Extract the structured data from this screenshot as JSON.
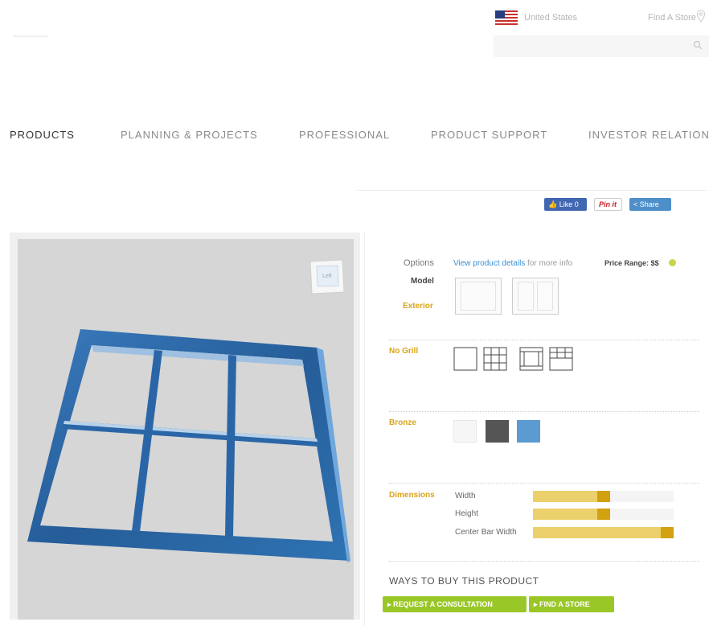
{
  "header": {
    "country": "United States",
    "find_store": "Find A Store"
  },
  "nav": {
    "items": [
      "PRODUCTS",
      "PLANNING & PROJECTS",
      "PROFESSIONAL",
      "PRODUCT SUPPORT",
      "INVESTOR RELATIONS"
    ],
    "active": "PRODUCTS"
  },
  "social": {
    "like": "Like 0",
    "pin": "Pin it",
    "share": "Share"
  },
  "viewer": {
    "cube_face": "Left",
    "frame_color": "#2f6da5",
    "background_color": "#d6d6d6"
  },
  "config": {
    "options_label": "Options",
    "details_link": "View product details",
    "details_suffix": "for more info",
    "price_range": "Price Range: $$",
    "model_label": "Model",
    "exterior_label": "Exterior",
    "grill_label": "No Grill",
    "finish_label": "Bronze",
    "swatches": [
      "#f6f6f6",
      "#555555",
      "#5b9bd1"
    ],
    "dimensions_label": "Dimensions",
    "dimensions": [
      {
        "label": "Width",
        "value": 0.55
      },
      {
        "label": "Height",
        "value": 0.55
      },
      {
        "label": "Center Bar Width",
        "value": 1.0
      }
    ],
    "ways_title": "WAYS TO BUY THIS PRODUCT",
    "consult_button": "REQUEST A CONSULTATION",
    "find_button": "FIND A STORE",
    "accent_color": "#d9a31b",
    "button_color": "#9ac728"
  }
}
